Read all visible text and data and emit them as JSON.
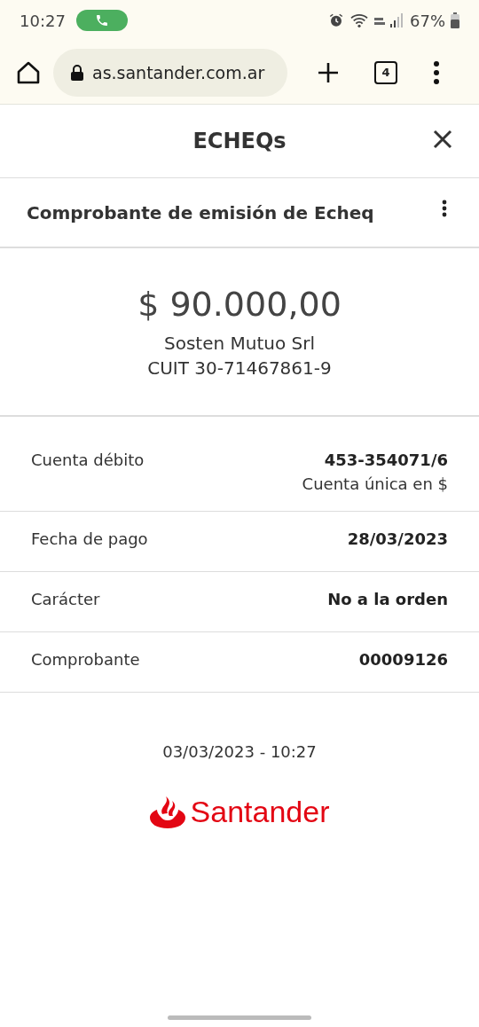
{
  "status_bar": {
    "time": "10:27",
    "battery": "67%"
  },
  "browser": {
    "url": "as.santander.com.ar",
    "tab_count": "4"
  },
  "header": {
    "title": "ECHEQs"
  },
  "subheader": {
    "title": "Comprobante de emisión de Echeq"
  },
  "summary": {
    "amount": "$ 90.000,00",
    "name": "Sosten Mutuo Srl",
    "cuit": "CUIT 30-71467861-9"
  },
  "details": [
    {
      "label": "Cuenta débito",
      "value": "453-354071/6",
      "note": "Cuenta única en $"
    },
    {
      "label": "Fecha de pago",
      "value": "28/03/2023"
    },
    {
      "label": "Carácter",
      "value": "No a la orden"
    },
    {
      "label": "Comprobante",
      "value": "00009126"
    }
  ],
  "timestamp": "03/03/2023 - 10:27",
  "logo": {
    "text": "Santander"
  }
}
